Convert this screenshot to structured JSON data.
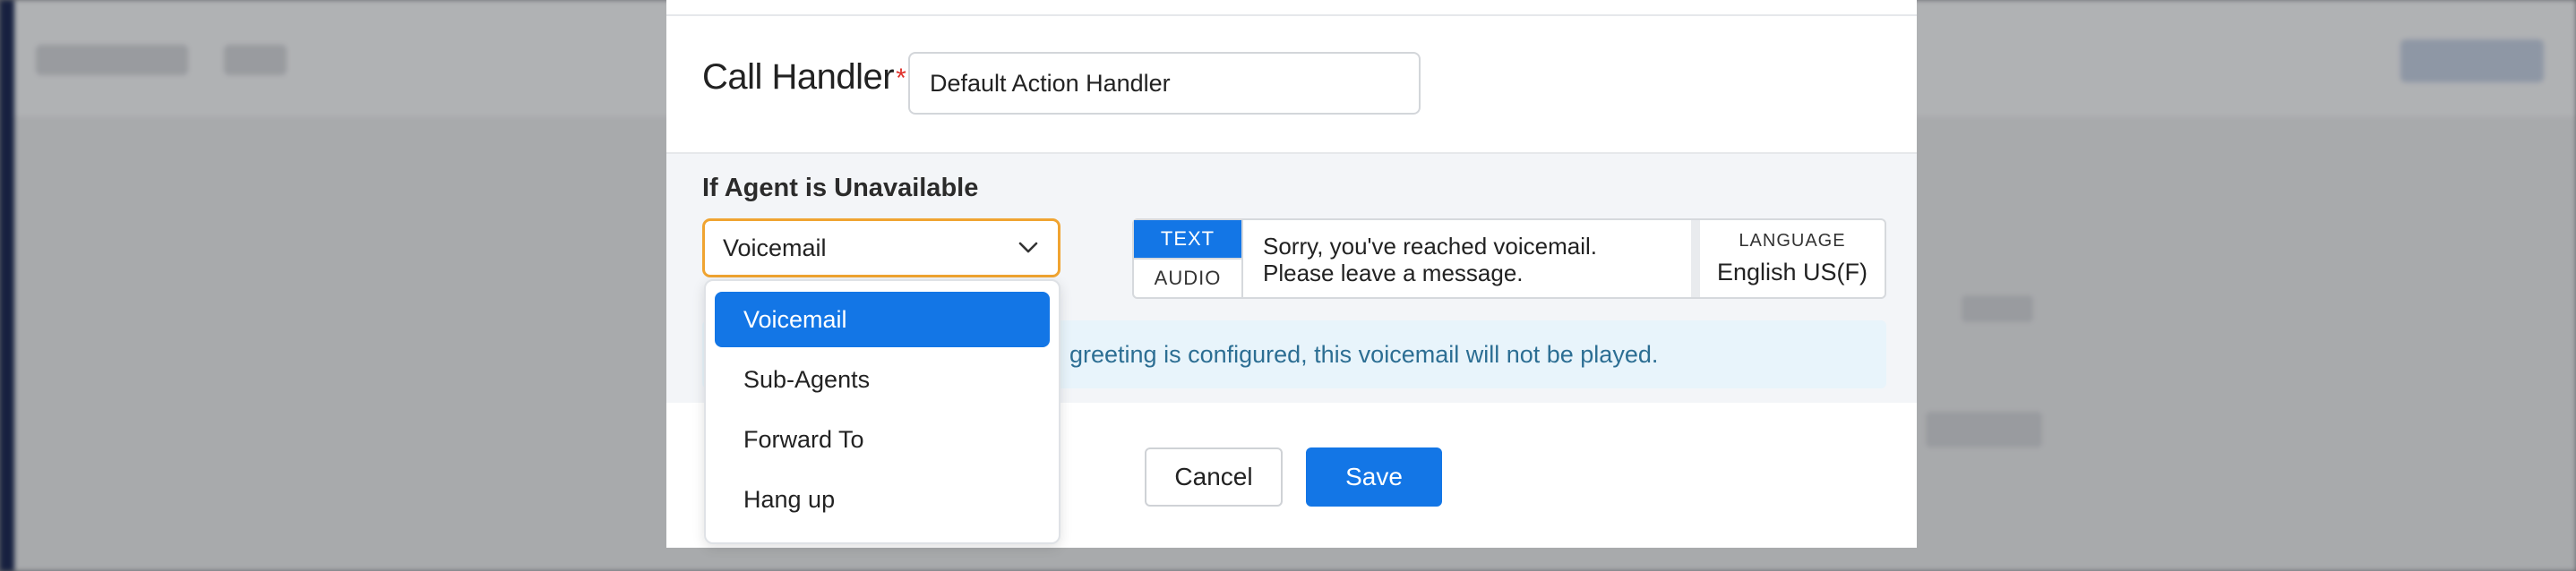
{
  "call_handler": {
    "label": "Call Handler",
    "required_mark": "*",
    "value": "Default Action Handler"
  },
  "unavailable": {
    "title": "If Agent is Unavailable",
    "selected": "Voicemail",
    "options": [
      "Voicemail",
      "Sub-Agents",
      "Forward To",
      "Hang up"
    ]
  },
  "message": {
    "tabs": {
      "text": "TEXT",
      "audio": "AUDIO"
    },
    "active_tab": "text",
    "line1": "Sorry, you've reached voicemail.",
    "line2": "Please leave a message.",
    "language_label": "LANGUAGE",
    "language_value": "English US(F)"
  },
  "info": {
    "text_visible": "greeting is configured, this voicemail will not be played."
  },
  "buttons": {
    "cancel": "Cancel",
    "save": "Save"
  },
  "colors": {
    "primary": "#1376e6",
    "select_focus": "#f0a431",
    "required": "#e0312b",
    "info_bg": "#e8f4fb",
    "info_text": "#2c6e93"
  }
}
